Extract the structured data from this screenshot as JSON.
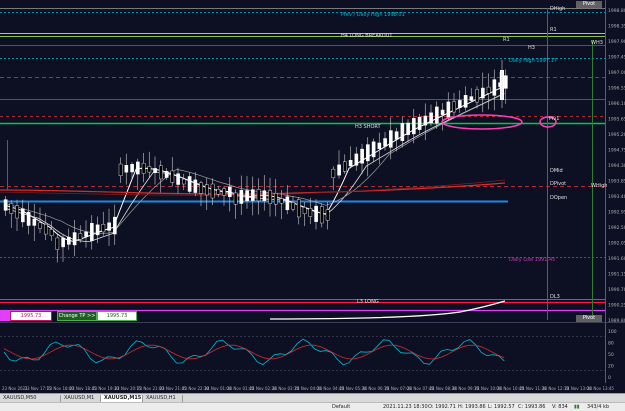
{
  "symbol_tabs": [
    "XAUUSD,M50 (offline)",
    "XAUUSD,M1",
    "XAUUSD,M15",
    "XAUUSD,H1"
  ],
  "active_tab_index": 2,
  "level_labels": {
    "pivot_top": "Pivot",
    "dhigh": "DHigh",
    "prev_daily_high": "Prev / Daily High 1998.01",
    "r1": "R1",
    "r1_short": "R1",
    "h4_long_breakout": "H4 LONG BREAKOUT",
    "wh3": "WH3",
    "h3": "H3",
    "daily_high": "Daily High 1997.17",
    "pivot_right": "Piv1",
    "h3_short": "H3 SHORT",
    "dmid": "DMid",
    "dpivot": "DPivot",
    "whigh": "WHigh",
    "dopen": "DOpen",
    "daily_low": "Daily Low 1991.45",
    "dl3": "DL3",
    "l3_long": "L3 LONG",
    "pivot_bottom": "Pivot"
  },
  "buttons": {
    "left_price": "1995.73",
    "change_tp": "Change TP >>",
    "right_price": "1995.73"
  },
  "price_axis": [
    "1998.80",
    "1998.35",
    "1997.90",
    "1997.45",
    "1997.00",
    "1996.55",
    "1996.10",
    "1995.65",
    "1995.20",
    "1994.75",
    "1994.30",
    "1993.85",
    "1993.40",
    "1992.95",
    "1992.50",
    "1992.05",
    "1991.60",
    "1991.15",
    "1990.70",
    "1990.25",
    "1989.80"
  ],
  "oscillator_axis": [
    "100",
    "80",
    "50",
    "20",
    "0"
  ],
  "time_axis": [
    "23 Nov 2021",
    "23 Nov 17:15",
    "23 Nov 18:00",
    "23 Nov 18:45",
    "23 Nov 19:30",
    "23 Nov 20:15",
    "23 Nov 21:00",
    "23 Nov 21:45",
    "23 Nov 22:30",
    "24 Nov 01:00",
    "24 Nov 01:45",
    "24 Nov 02:30",
    "24 Nov 03:15",
    "24 Nov 04:00",
    "24 Nov 04:45",
    "24 Nov 05:30",
    "24 Nov 06:15",
    "24 Nov 07:00",
    "24 Nov 07:45",
    "24 Nov 08:30",
    "24 Nov 09:15",
    "24 Nov 10:00",
    "24 Nov 10:45",
    "24 Nov 11:30",
    "24 Nov 12:15",
    "24 Nov 13:00",
    "24 Nov 13:45"
  ],
  "status_bar": {
    "profile": "Default",
    "datetime": "2021.11.23 18:30",
    "open": "O: 1992.71",
    "high": "H: 1993.86",
    "low": "L: 1992.57",
    "close": "C: 1993.86",
    "volume": "V: 834",
    "traffic": "343/4 kb"
  },
  "colors": {
    "background": "#0d0f22",
    "bull_candle": "#ffffff",
    "bear_candle": "#000000",
    "h4_long": "#8bc34a",
    "h3_short": "#00c853",
    "resistance": "#e53935",
    "dopen": "#1e88e5",
    "l3_long": "#ff1744",
    "daily_low": "#c239b3"
  }
}
